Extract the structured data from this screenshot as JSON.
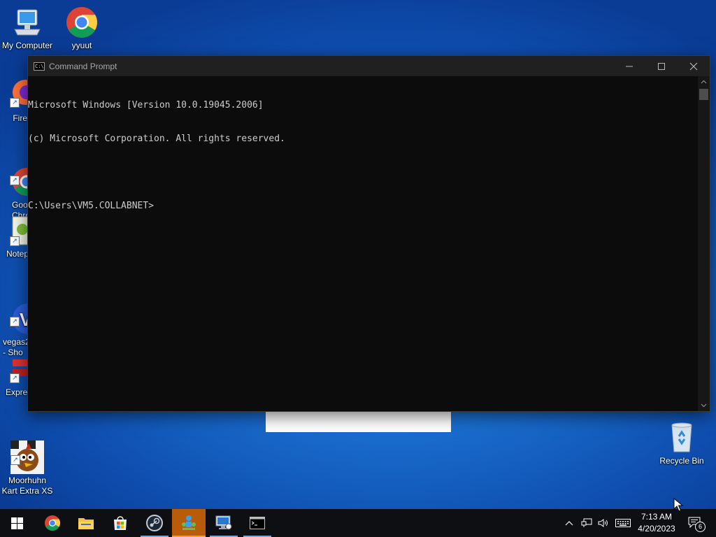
{
  "desktop": {
    "icons": [
      {
        "label": "My Computer"
      },
      {
        "label": "yyuut"
      },
      {
        "label": "Fire"
      },
      {
        "label": "Goo\nChro"
      },
      {
        "label": "Notep"
      },
      {
        "label": "vegas2\n- Sho"
      },
      {
        "label": "Expre"
      },
      {
        "label": "Moorhuhn\nKart Extra XS"
      },
      {
        "label": "Recycle Bin"
      }
    ]
  },
  "cmd_window": {
    "title": "Command Prompt",
    "lines": [
      "Microsoft Windows [Version 10.0.19045.2006]",
      "(c) Microsoft Corporation. All rights reserved.",
      "",
      "C:\\Users\\VM5.COLLABNET>"
    ]
  },
  "taskbar": {
    "items": [
      {
        "name": "start",
        "icon": "windows-logo-icon"
      },
      {
        "name": "chrome",
        "icon": "chrome-icon"
      },
      {
        "name": "file-explorer",
        "icon": "folder-icon"
      },
      {
        "name": "microsoft-store",
        "icon": "store-icon"
      },
      {
        "name": "steam",
        "icon": "steam-icon"
      },
      {
        "name": "network-app",
        "icon": "network-app-icon"
      },
      {
        "name": "remote-desktop",
        "icon": "remote-desktop-icon"
      },
      {
        "name": "command-prompt",
        "icon": "cmd-icon"
      }
    ],
    "tray": {
      "time": "7:13 AM",
      "date": "4/20/2023",
      "notification_count": "6"
    }
  },
  "colors": {
    "taskbar_bg": "#0e0f12",
    "active_task": "#b85c0a",
    "console_bg": "#0c0c0c",
    "console_text": "#cccccc"
  }
}
